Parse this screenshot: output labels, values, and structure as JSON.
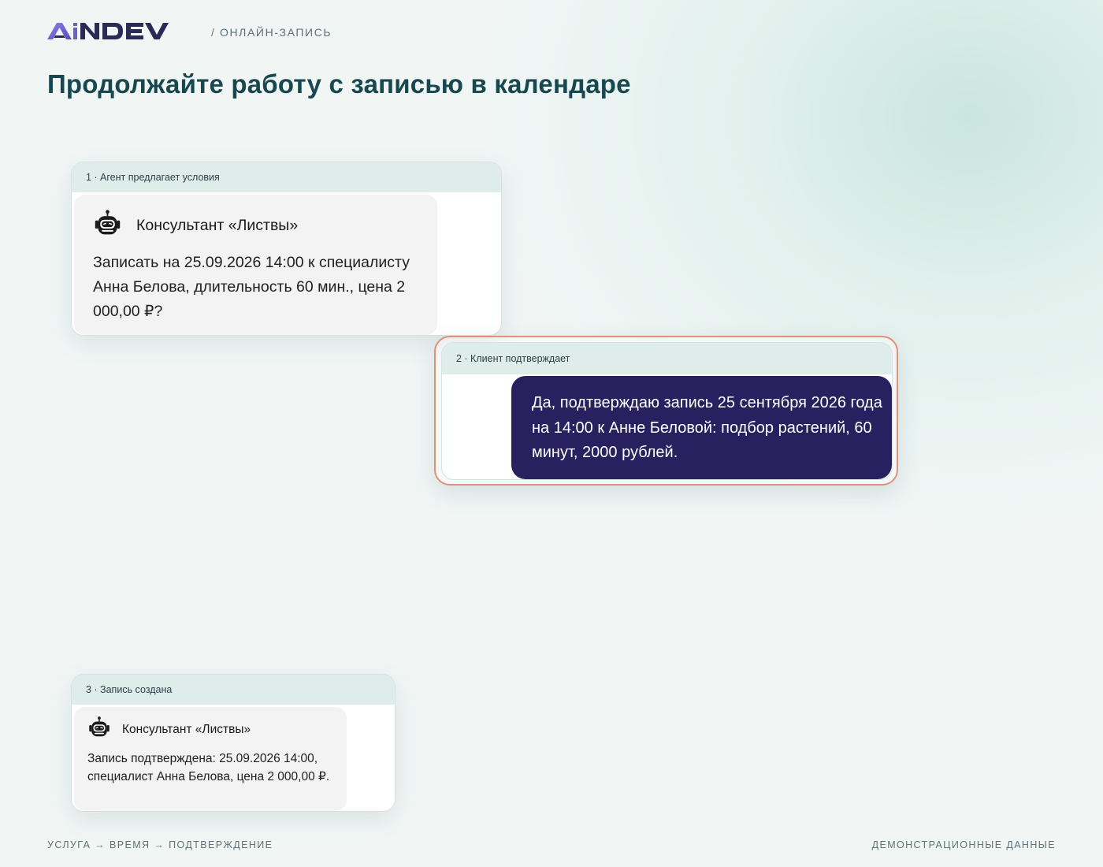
{
  "header": {
    "logo_text": "AiNDEV",
    "breadcrumb": "/ ОНЛАЙН-ЗАПИСЬ"
  },
  "page_title": "Продолжайте работу с записью в календаре",
  "steps": [
    {
      "label": "1 · Агент предлагает условия",
      "agent_name": "Консультант «Листвы»",
      "agent_icon": "robot-icon",
      "message": "Записать на 25.09.2026 14:00 к специалисту Анна Белова, длительность 60 мин., цена 2 000,00 ₽?"
    },
    {
      "label": "2 · Клиент подтверждает",
      "message": "Да, подтверждаю запись 25 сентября 2026 года на 14:00 к Анне Беловой: подбор растений, 60 минут, 2000 рублей.",
      "highlighted": true
    },
    {
      "label": "3 · Запись создана",
      "agent_name": "Консультант «Листвы»",
      "agent_icon": "robot-icon",
      "message": "Запись подтверждена: 25.09.2026 14:00, специалист Анна Белова, цена 2 000,00 ₽."
    }
  ],
  "footer": {
    "left": "УСЛУГА → ВРЕМЯ → ПОДТВЕРЖДЕНИЕ",
    "right": "ДЕМОНСТРАЦИОННЫЕ ДАННЫЕ"
  },
  "colors": {
    "title": "#17474f",
    "card_header": "#deecea",
    "client_bubble": "#29215f",
    "agent_bubble": "#f3f3f3",
    "highlight_ring": "#e0907b",
    "logo_ai": "#6c5fc7",
    "logo_ndev": "#2a2a55"
  }
}
